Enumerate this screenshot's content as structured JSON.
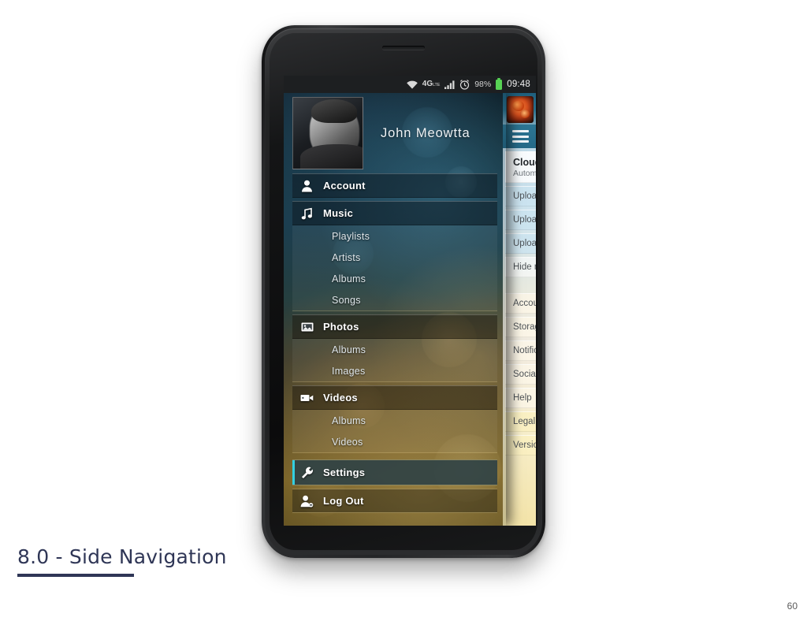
{
  "slide": {
    "caption": "8.0 - Side Navigation",
    "page_number": "60"
  },
  "status_bar": {
    "wifi_icon": "wifi-icon",
    "network_label": "4G",
    "network_sub": "LTE",
    "signal_icon": "signal-bars-icon",
    "alarm_icon": "alarm-clock-icon",
    "battery_percent": "98%",
    "battery_icon": "battery-full-icon",
    "clock": "09:48"
  },
  "profile": {
    "name": "John Meowtta",
    "avatar_name": "user-avatar"
  },
  "drawer": {
    "groups": [
      {
        "primary": {
          "label": "Account",
          "icon": "person-icon",
          "tone": "cool"
        },
        "sub_items": []
      },
      {
        "primary": {
          "label": "Music",
          "icon": "music-note-icon",
          "tone": "cool"
        },
        "sub_items": [
          {
            "label": "Playlists"
          },
          {
            "label": "Artists"
          },
          {
            "label": "Albums"
          },
          {
            "label": "Songs"
          }
        ]
      },
      {
        "primary": {
          "label": "Photos",
          "icon": "photo-icon",
          "tone": "warm"
        },
        "sub_items": [
          {
            "label": "Albums"
          },
          {
            "label": "Images"
          }
        ]
      },
      {
        "primary": {
          "label": "Videos",
          "icon": "video-camera-icon",
          "tone": "warm"
        },
        "sub_items": [
          {
            "label": "Albums"
          },
          {
            "label": "Videos"
          }
        ]
      }
    ],
    "settings_item": {
      "label": "Settings",
      "icon": "wrench-icon",
      "selected": true
    },
    "logout_item": {
      "label": "Log Out",
      "icon": "person-remove-icon"
    }
  },
  "settings_panel": {
    "app_icon": "app-icon",
    "menu_icon": "hamburger-menu-icon",
    "section_header": {
      "title": "Cloud",
      "subtitle": "Autom"
    },
    "rows": [
      {
        "label": "Uploa",
        "tone": "blue"
      },
      {
        "label": "Uploa",
        "tone": "blue"
      },
      {
        "label": "Uploa",
        "tone": "blue"
      },
      {
        "label": "Hide n",
        "tone": "plain"
      },
      {
        "label": "Accou",
        "tone": "cream"
      },
      {
        "label": "Storag",
        "tone": "cream"
      },
      {
        "label": "Notific",
        "tone": "cream"
      },
      {
        "label": "Social",
        "tone": "cream"
      },
      {
        "label": "Help",
        "tone": "cream"
      },
      {
        "label": "Legal",
        "tone": "gold"
      },
      {
        "label": "Versio",
        "tone": "gold"
      }
    ]
  },
  "colors": {
    "accent_cyan": "#33cfe0",
    "selected_row": "#2b4046",
    "battery_green": "#57d254",
    "caption_navy": "#2f3656",
    "panel_teal": "#2d7694"
  }
}
